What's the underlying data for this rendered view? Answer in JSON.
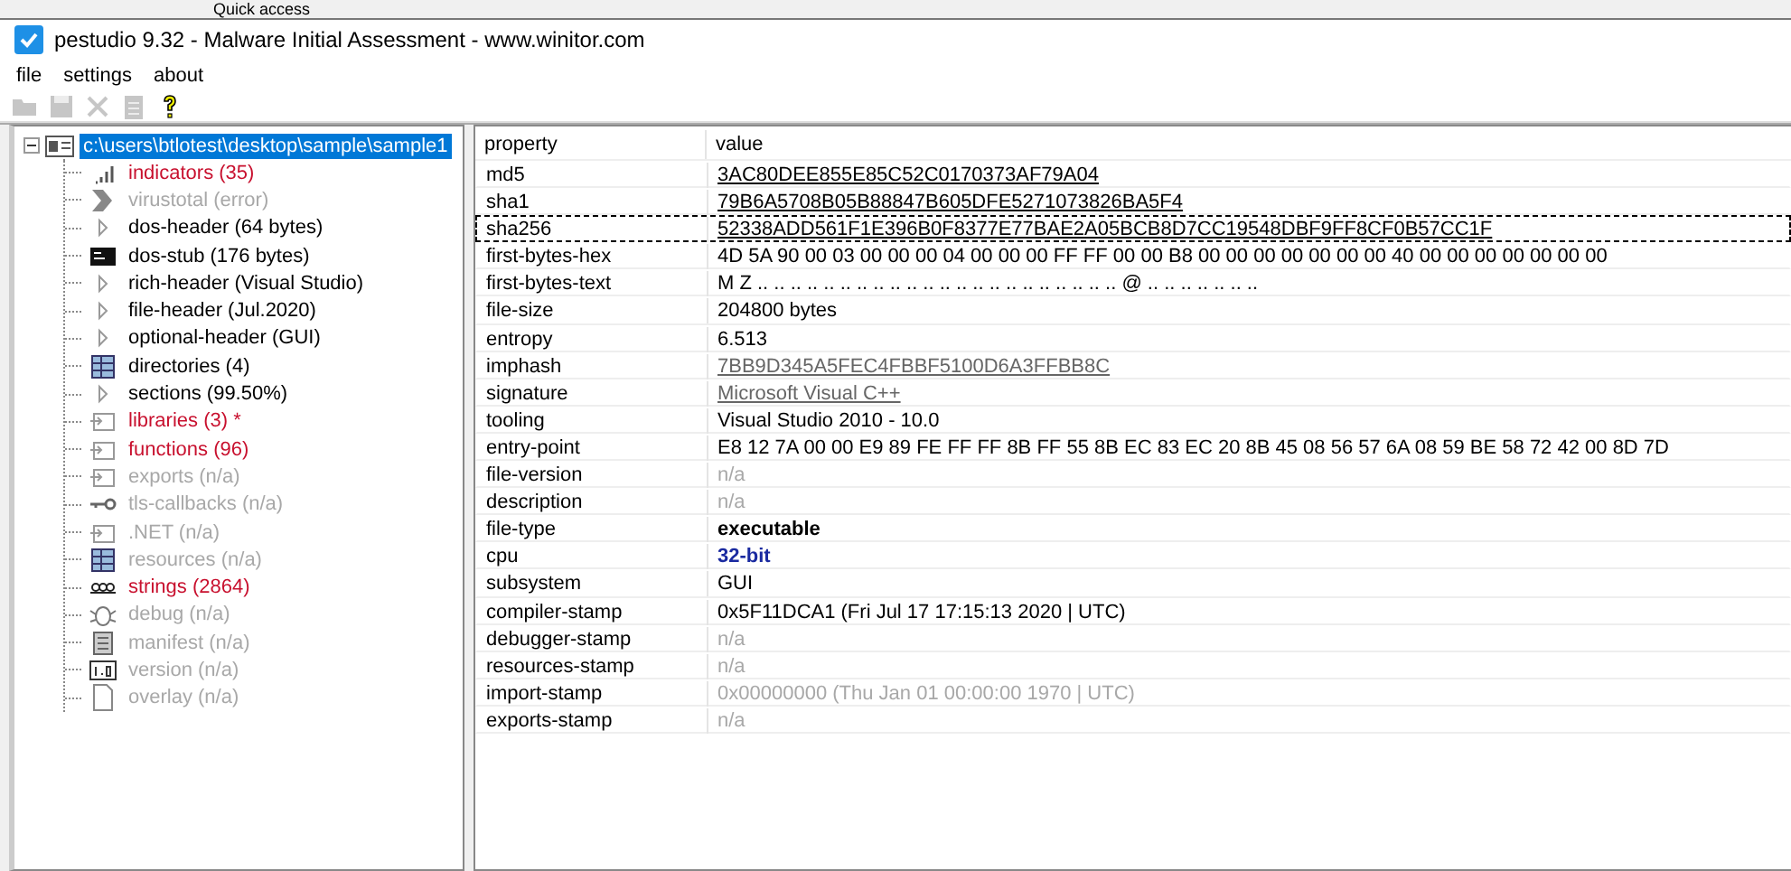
{
  "background_window": {
    "item": "Quick access"
  },
  "window": {
    "title": "pestudio 9.32 - Malware Initial Assessment - www.winitor.com"
  },
  "menu": [
    "file",
    "settings",
    "about"
  ],
  "toolbar": [
    {
      "disabled": true
    },
    {
      "disabled": true
    },
    {
      "disabled": true
    },
    {
      "disabled": true
    },
    {
      "disabled": false
    }
  ],
  "tree": {
    "root": {
      "label": "c:\\users\\btlotest\\desktop\\sample\\sample1",
      "selected": true,
      "expanded": true,
      "children": [
        {
          "label": "indicators (35)",
          "flagged": true,
          "disabled": false
        },
        {
          "label": "virustotal (error)",
          "flagged": false,
          "disabled": true
        },
        {
          "label": "dos-header (64 bytes)",
          "flagged": false,
          "disabled": false
        },
        {
          "label": "dos-stub (176 bytes)",
          "flagged": false,
          "disabled": false
        },
        {
          "label": "rich-header (Visual Studio)",
          "flagged": false,
          "disabled": false
        },
        {
          "label": "file-header (Jul.2020)",
          "flagged": false,
          "disabled": false
        },
        {
          "label": "optional-header (GUI)",
          "flagged": false,
          "disabled": false
        },
        {
          "label": "directories (4)",
          "flagged": false,
          "disabled": false
        },
        {
          "label": "sections (99.50%)",
          "flagged": false,
          "disabled": false
        },
        {
          "label": "libraries (3) *",
          "flagged": true,
          "disabled": false
        },
        {
          "label": "functions (96)",
          "flagged": true,
          "disabled": false
        },
        {
          "label": "exports (n/a)",
          "flagged": false,
          "disabled": true
        },
        {
          "label": "tls-callbacks (n/a)",
          "flagged": false,
          "disabled": true
        },
        {
          "label": ".NET (n/a)",
          "flagged": false,
          "disabled": true
        },
        {
          "label": "resources (n/a)",
          "flagged": false,
          "disabled": true
        },
        {
          "label": "strings (2864)",
          "flagged": true,
          "disabled": false
        },
        {
          "label": "debug (n/a)",
          "flagged": false,
          "disabled": true
        },
        {
          "label": "manifest (n/a)",
          "flagged": false,
          "disabled": true
        },
        {
          "label": "version (n/a)",
          "flagged": false,
          "disabled": true
        },
        {
          "label": "overlay (n/a)",
          "flagged": false,
          "disabled": true
        }
      ]
    }
  },
  "table": {
    "columns": [
      "property",
      "value"
    ],
    "rows": [
      {
        "property": "md5",
        "value": "3AC80DEE855E85C52C0170373AF79A04",
        "kind": "link",
        "focused": false
      },
      {
        "property": "sha1",
        "value": "79B6A5708B05B88847B605DFE5271073826BA5F4",
        "kind": "link",
        "focused": false
      },
      {
        "property": "sha256",
        "value": "52338ADD561F1E396B0F8377E77BAE2A05BCB8D7CC19548DBF9FF8CF0B57CC1F",
        "kind": "link",
        "focused": true
      },
      {
        "property": "first-bytes-hex",
        "value": "4D 5A 90 00 03 00 00 00 04 00 00 00 FF FF 00 00 B8 00 00 00 00 00 00 00 40 00 00 00 00 00 00 00",
        "kind": "plain",
        "focused": false
      },
      {
        "property": "first-bytes-text",
        "value": "M Z .. .. .. .. .. .. .. .. .. .. .. .. .. .. .. .. .. .. .. .. .. .. @ .. .. .. .. .. .. ..",
        "kind": "plain",
        "focused": false
      },
      {
        "property": "file-size",
        "value": "204800 bytes",
        "kind": "plain",
        "focused": false
      },
      {
        "property": "entropy",
        "value": "6.513",
        "kind": "plain",
        "focused": false
      },
      {
        "property": "imphash",
        "value": "7BB9D345A5FEC4FBBF5100D6A3FFBB8C",
        "kind": "link-muted",
        "focused": false
      },
      {
        "property": "signature",
        "value": "Microsoft Visual C++",
        "kind": "link-muted",
        "focused": false
      },
      {
        "property": "tooling",
        "value": "Visual Studio 2010 - 10.0",
        "kind": "plain",
        "focused": false
      },
      {
        "property": "entry-point",
        "value": "E8 12 7A 00 00 E9 89 FE FF FF 8B FF 55 8B EC 83 EC 20 8B 45 08 56 57 6A 08 59 BE 58 72 42 00 8D 7D",
        "kind": "plain",
        "focused": false
      },
      {
        "property": "file-version",
        "value": "n/a",
        "kind": "muted",
        "focused": false
      },
      {
        "property": "description",
        "value": "n/a",
        "kind": "muted",
        "focused": false
      },
      {
        "property": "file-type",
        "value": "executable",
        "kind": "bold",
        "focused": false
      },
      {
        "property": "cpu",
        "value": "32-bit",
        "kind": "bold-blue",
        "focused": false
      },
      {
        "property": "subsystem",
        "value": "GUI",
        "kind": "plain",
        "focused": false
      },
      {
        "property": "compiler-stamp",
        "value": "0x5F11DCA1 (Fri Jul 17 17:15:13 2020 | UTC)",
        "kind": "plain",
        "focused": false
      },
      {
        "property": "debugger-stamp",
        "value": "n/a",
        "kind": "muted",
        "focused": false
      },
      {
        "property": "resources-stamp",
        "value": "n/a",
        "kind": "muted",
        "focused": false
      },
      {
        "property": "import-stamp",
        "value": "0x00000000 (Thu Jan 01 00:00:00 1970 | UTC)",
        "kind": "muted",
        "focused": false
      },
      {
        "property": "exports-stamp",
        "value": "n/a",
        "kind": "muted",
        "focused": false
      }
    ]
  }
}
